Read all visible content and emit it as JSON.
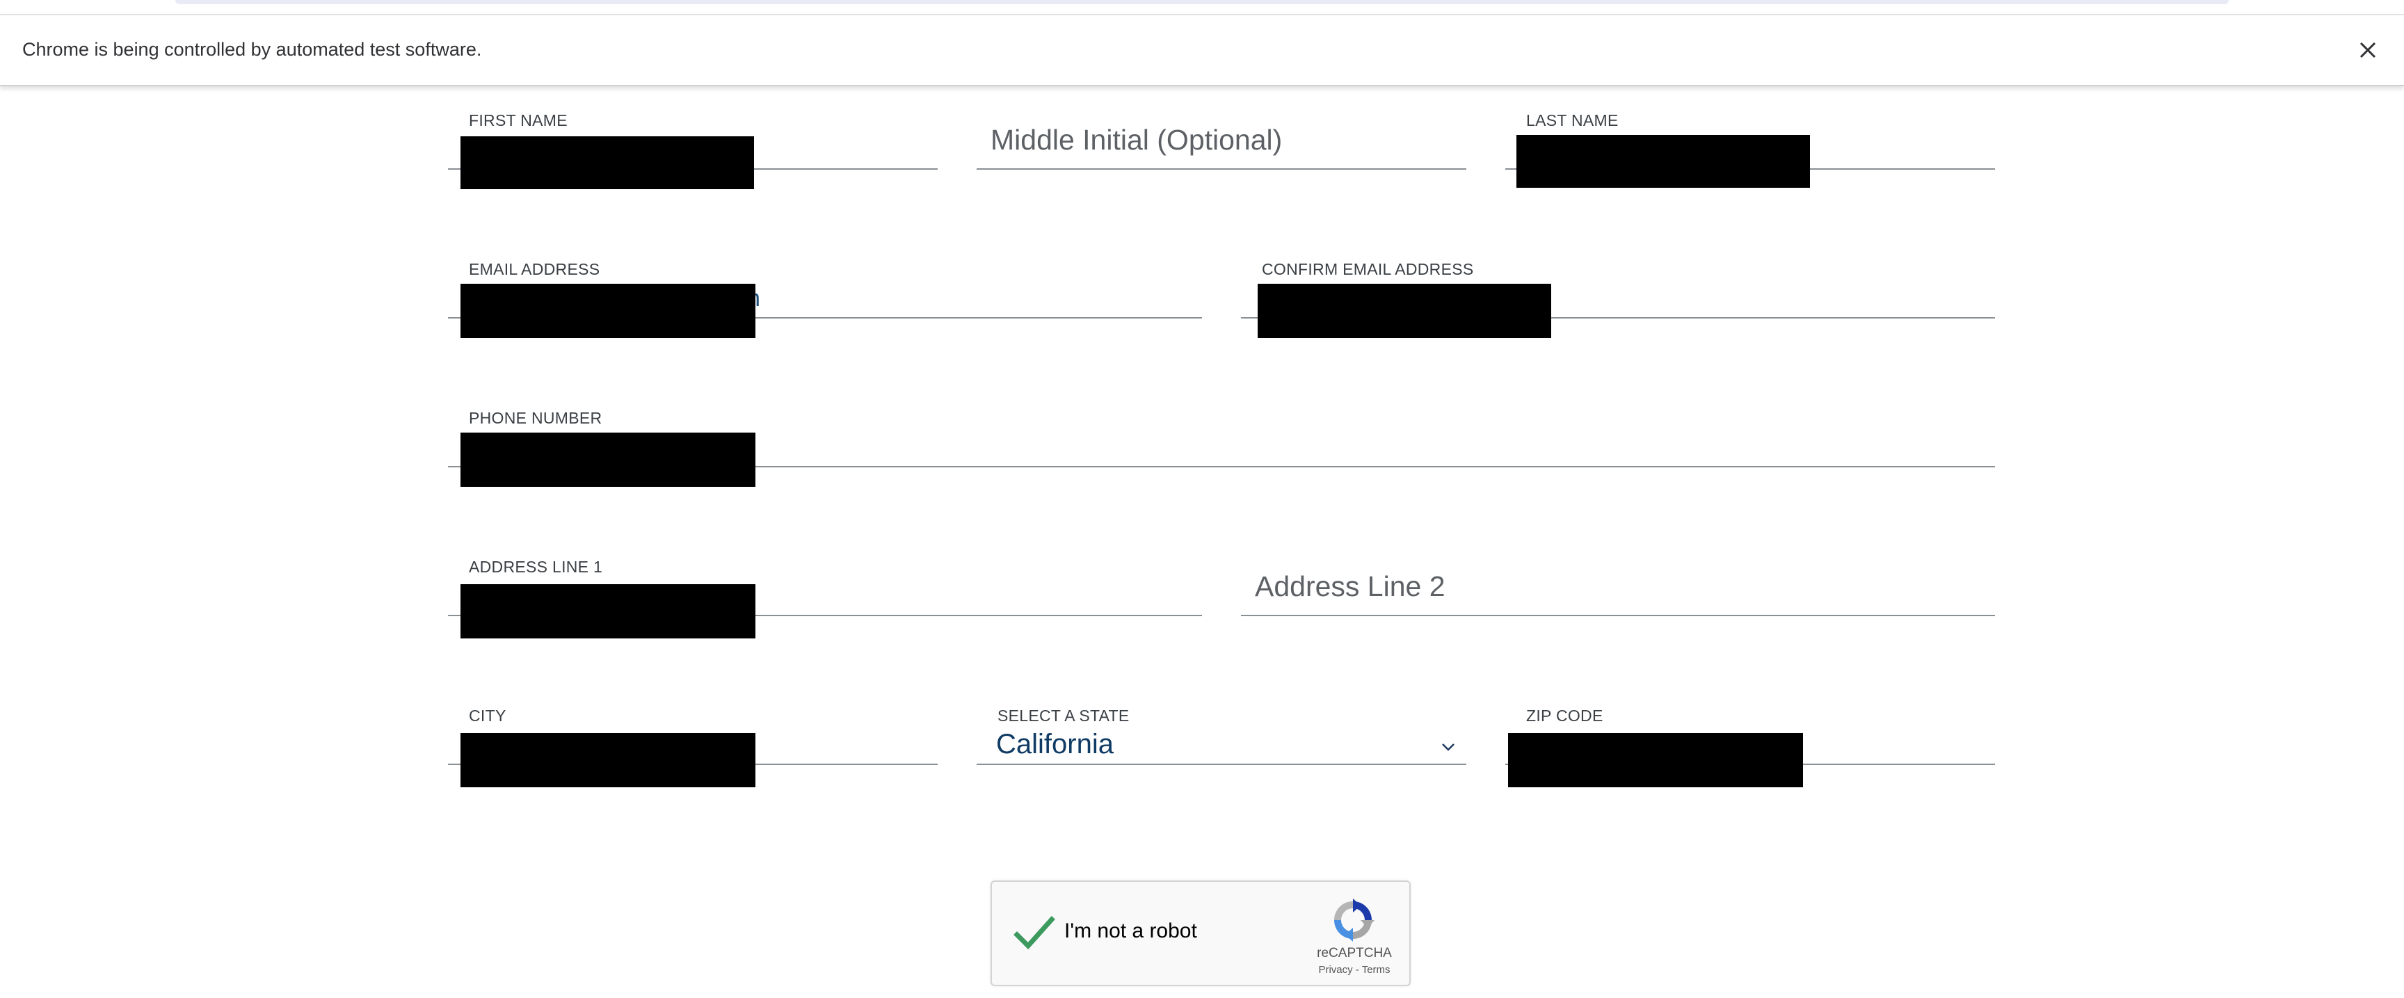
{
  "browser": {
    "infobar_message": "Chrome is being controlled by automated test software.",
    "close_icon": "×"
  },
  "form": {
    "first_name": {
      "label": "FIRST NAME"
    },
    "middle_initial": {
      "placeholder": "Middle Initial (Optional)"
    },
    "last_name": {
      "label": "LAST NAME"
    },
    "email": {
      "label": "EMAIL ADDRESS",
      "visible_tail": "n"
    },
    "confirm_email": {
      "label": "CONFIRM EMAIL ADDRESS"
    },
    "phone": {
      "label": "PHONE NUMBER"
    },
    "address1": {
      "label": "ADDRESS LINE 1"
    },
    "address2": {
      "placeholder": "Address Line 2"
    },
    "city": {
      "label": "CITY"
    },
    "state": {
      "label": "SELECT A STATE",
      "value": "California",
      "icon": "chevron-down-icon"
    },
    "zip": {
      "label": "ZIP CODE"
    }
  },
  "recaptcha": {
    "label": "I'm not a robot",
    "brand": "reCAPTCHA",
    "privacy": "Privacy",
    "separator": " - ",
    "terms": "Terms",
    "checked": true,
    "check_color": "#0f9d58"
  }
}
